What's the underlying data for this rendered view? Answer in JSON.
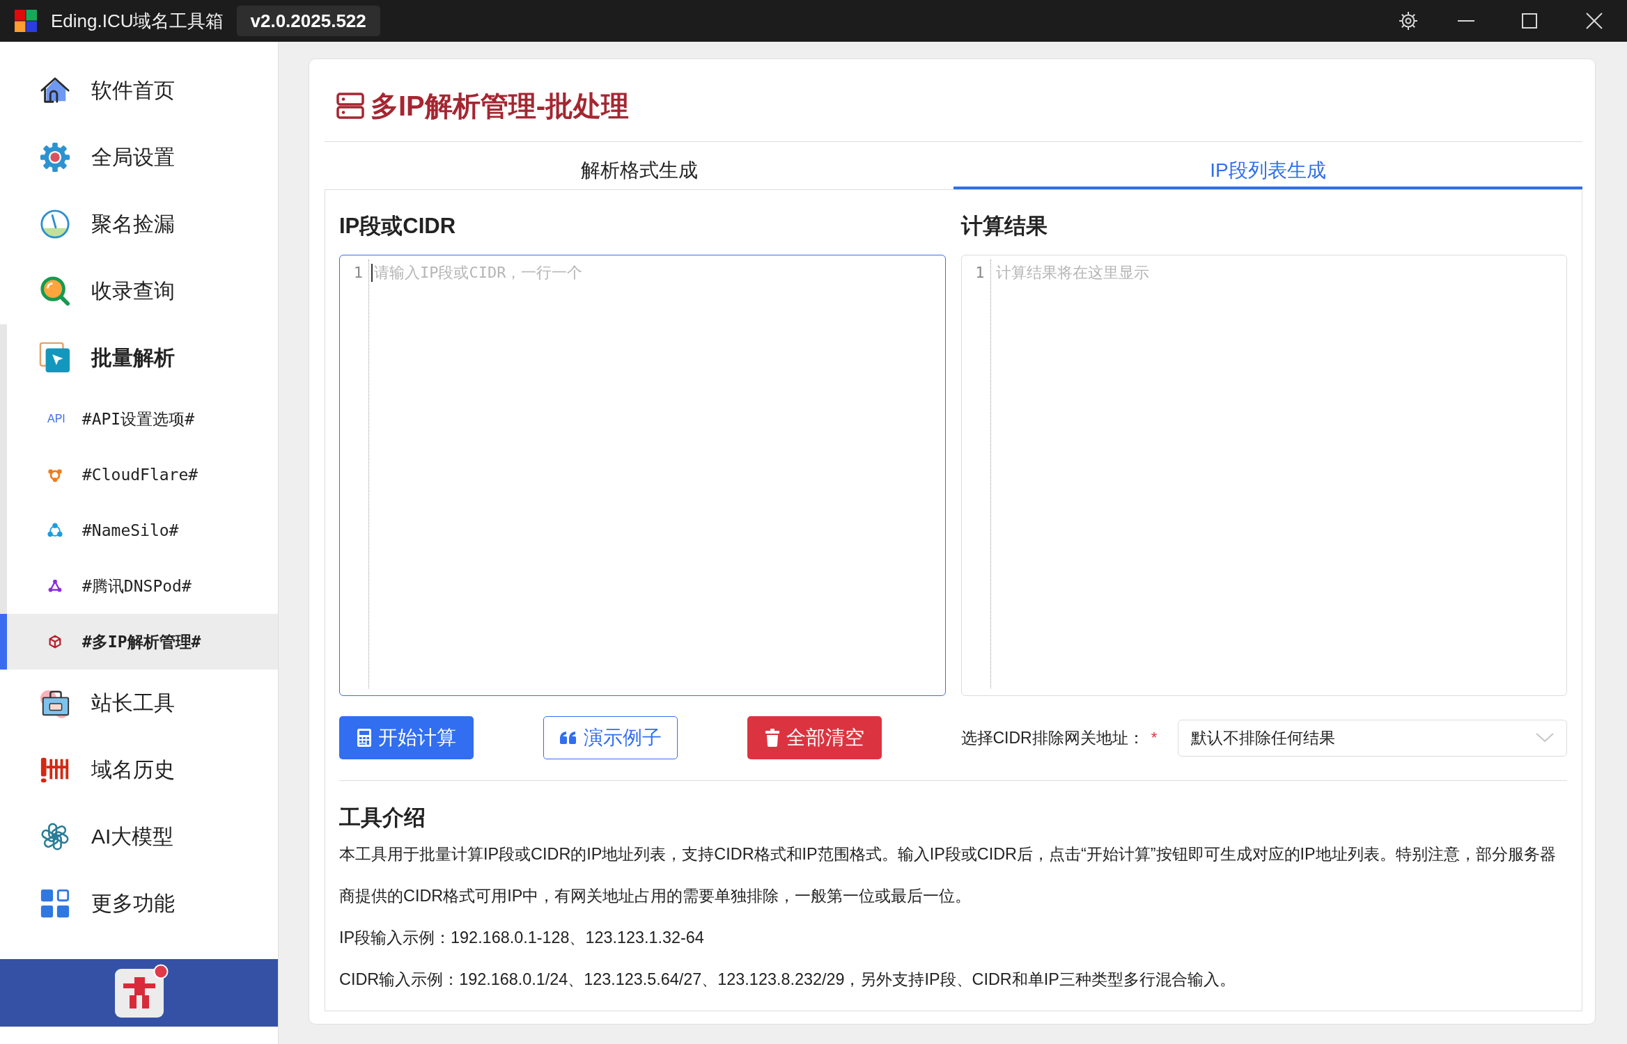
{
  "window": {
    "title": "Eding.ICU域名工具箱",
    "version": "v2.0.2025.522"
  },
  "sidebar": {
    "items": [
      {
        "label": "软件首页",
        "selected": false,
        "expanded": false
      },
      {
        "label": "全局设置",
        "selected": false,
        "expanded": false
      },
      {
        "label": "聚名捡漏",
        "selected": false,
        "expanded": false
      },
      {
        "label": "收录查询",
        "selected": false,
        "expanded": false
      },
      {
        "label": "批量解析",
        "selected": false,
        "expanded": true,
        "children": [
          {
            "label": "#API设置选项#",
            "badge": "API",
            "selected": false
          },
          {
            "label": "#CloudFlare#",
            "selected": false
          },
          {
            "label": "#NameSilo#",
            "selected": false
          },
          {
            "label": "#腾讯DNSPod#",
            "selected": false
          },
          {
            "label": "#多IP解析管理#",
            "selected": true
          }
        ]
      },
      {
        "label": "站长工具",
        "selected": false,
        "expanded": false
      },
      {
        "label": "域名历史",
        "selected": false,
        "expanded": false
      },
      {
        "label": "AI大模型",
        "selected": false,
        "expanded": false
      },
      {
        "label": "更多功能",
        "selected": false,
        "expanded": false
      }
    ],
    "member": {
      "notification": true
    }
  },
  "page": {
    "title": "多IP解析管理-批处理",
    "tabs": [
      {
        "label": "解析格式生成",
        "selected": false
      },
      {
        "label": "IP段列表生成",
        "selected": true
      }
    ],
    "input_panel": {
      "heading": "IP段或CIDR",
      "line_number": "1",
      "placeholder": "请输入IP段或CIDR，一行一个",
      "focused": true
    },
    "result_panel": {
      "heading": "计算结果",
      "line_number": "1",
      "placeholder": "计算结果将在这里显示",
      "focused": false
    },
    "buttons": [
      {
        "label": "开始计算",
        "kind": "primary"
      },
      {
        "label": "演示例子",
        "kind": "outline"
      },
      {
        "label": "全部清空",
        "kind": "danger"
      }
    ],
    "gateway_select": {
      "label": "选择CIDR排除网关地址：",
      "required_mark": "*",
      "value": "默认不排除任何结果"
    },
    "intro": {
      "heading": "工具介绍",
      "paragraphs": [
        "本工具用于批量计算IP段或CIDR的IP地址列表，支持CIDR格式和IP范围格式。输入IP段或CIDR后，点击“开始计算”按钮即可生成对应的IP地址列表。特别注意，部分服务器商提供的CIDR格式可用IP中，有网关地址占用的需要单独排除，一般第一位或最后一位。",
        "IP段输入示例：192.168.0.1-128、123.123.1.32-64",
        "CIDR输入示例：192.168.0.1/24、123.123.5.64/27、123.123.8.232/29，另外支持IP段、CIDR和单IP三种类型多行混合输入。"
      ]
    }
  }
}
